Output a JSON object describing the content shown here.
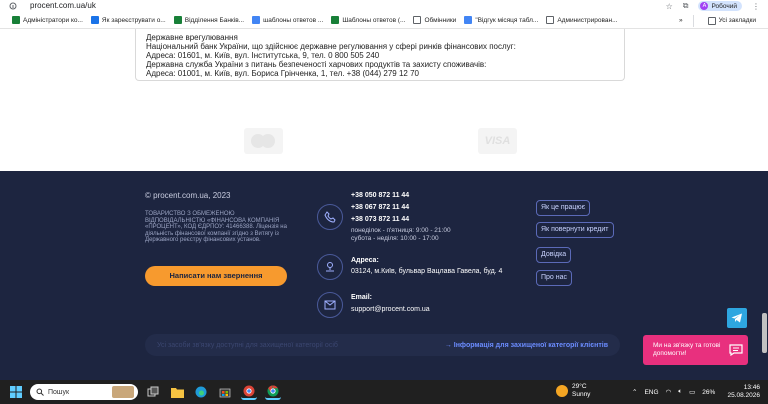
{
  "browser": {
    "url": "procent.com.ua/uk",
    "profile_label": "Робочий",
    "profile_initial": "А",
    "bookmarks": [
      {
        "label": "Адміністратори ко...",
        "icon": "green"
      },
      {
        "label": "Як зареєструвати о...",
        "icon": "blue"
      },
      {
        "label": "Відділення Банків...",
        "icon": "green"
      },
      {
        "label": "шаблоны ответов ...",
        "icon": "doc"
      },
      {
        "label": "Шаблоны ответов (...",
        "icon": "green"
      },
      {
        "label": "Обмінники",
        "icon": "bank"
      },
      {
        "label": "\"Відгук місяця табл...",
        "icon": "doc"
      },
      {
        "label": "Администрирован...",
        "icon": "folder"
      }
    ],
    "overflow": "»",
    "all_bookmarks": "Усі закладки"
  },
  "info_box": {
    "lines": [
      "Державне врегулювання",
      "Національний банк України, що здійснює державне регулювання у сферi ринкiв фiнансових послуг:",
      "Адреса: 01601, м. Київ, вул. Інститутська, 9, тел. 0 800 505 240",
      "Державна служба України з питань безпеченостi харчових продуктiв та захисту споживачiв:",
      "Адреса: 01001, м. Київ, вул. Бориса Грiнченка, 1, тел. +38 (044) 279 12 70"
    ]
  },
  "payment": {
    "visa": "VISA"
  },
  "footer": {
    "copyright": "© procent.com.ua, 2023",
    "company": "ТОВАРИСТВО З ОБМЕЖЕНОЮ ВІДПОВІДАЛЬНІСТЮ «ФІНАНСОВА КОМПАНІЯ «ПРОЦЕНТ», код ЄДРПОУ: 41466388.",
    "license": "Ліцензія на діяльність фінансової компанії згідно з Витягу iз Державного реєстру фінансових установ.",
    "cta": "Написати нам звернення",
    "phones": [
      "+38 050 872 11 44",
      "+38 067 872 11 44",
      "+38 073 872 11 44"
    ],
    "hours": [
      "понеділок - п'ятниця: 9:00 - 21:00",
      "субота - неділя: 10:00 - 17:00"
    ],
    "address_label": "Адреса:",
    "address": "03124, м.Київ, бульвар Вацлава Гавела, буд. 4",
    "email_label": "Email:",
    "email": "support@procent.com.ua",
    "links": [
      "Як це працює",
      "Як повернути кредит",
      "Довідка",
      "Про нас"
    ],
    "special_text": "Усі засоби зв'язку доступні для захищеної категорії осіб",
    "special_link": "→ Інформація для захищеної категорії клієнтів",
    "chat_text": "Ми на зв'язку та готові допомогти!"
  },
  "taskbar": {
    "search": "Пошук",
    "weather_temp": "29°C",
    "weather_desc": "Sunny",
    "lang": "ENG",
    "battery": "26%",
    "time": "13:46",
    "date": "25.08.2026"
  },
  "colors": {
    "footer_bg": "#1d2540",
    "cta": "#f79a2e",
    "chat": "#e8307e",
    "telegram": "#2ea6e0",
    "link": "#6b8cff"
  }
}
